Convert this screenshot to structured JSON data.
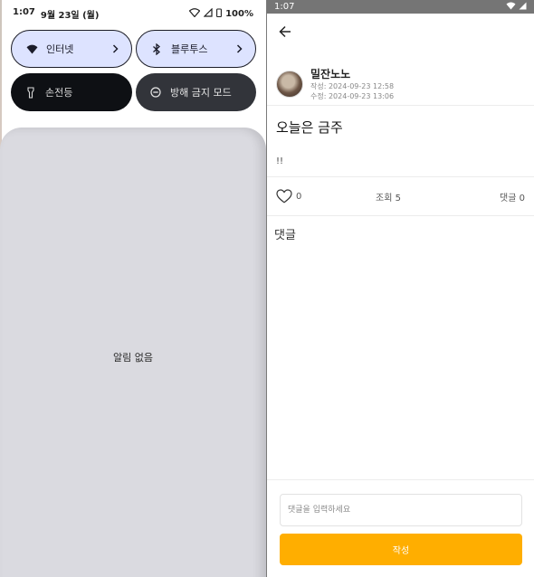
{
  "shade": {
    "status": {
      "time": "1:07",
      "date": "9월 23일 (월)",
      "battery": "100%"
    },
    "tiles": [
      {
        "label": "인터넷",
        "icon": "wifi-icon"
      },
      {
        "label": "블루투스",
        "icon": "bluetooth-icon"
      },
      {
        "label": "손전등",
        "icon": "flashlight-icon"
      },
      {
        "label": "방해 금지 모드",
        "icon": "do-not-disturb-icon"
      }
    ],
    "empty_text": "알림 없음"
  },
  "app": {
    "status_time": "1:07",
    "author": {
      "name": "밀잔노노",
      "created": "작성: 2024-09-23 12:58",
      "modified": "수정: 2024-09-23 13:06"
    },
    "post": {
      "title": "오늘은 금주",
      "body": "!!"
    },
    "stats": {
      "likes": "0",
      "views": "조회 5",
      "comments": "댓글 0"
    },
    "comments_title": "댓글",
    "comment_input": {
      "placeholder": "댓글을 입력하세요",
      "value": ""
    },
    "submit_label": "작성",
    "colors": {
      "accent": "#ffae00",
      "status_bar": "#757575",
      "tile_active": "#dde3ff"
    }
  }
}
